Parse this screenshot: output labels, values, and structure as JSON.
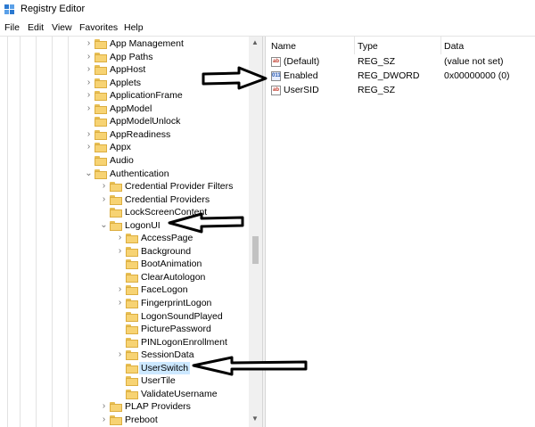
{
  "window": {
    "title": "Registry Editor",
    "icon": "regedit-icon"
  },
  "menu": [
    "File",
    "Edit",
    "View",
    "Favorites",
    "Help"
  ],
  "tree": [
    {
      "label": "App Management",
      "level": 0,
      "expander": "closed"
    },
    {
      "label": "App Paths",
      "level": 0,
      "expander": "closed"
    },
    {
      "label": "AppHost",
      "level": 0,
      "expander": "closed"
    },
    {
      "label": "Applets",
      "level": 0,
      "expander": "closed"
    },
    {
      "label": "ApplicationFrame",
      "level": 0,
      "expander": "closed"
    },
    {
      "label": "AppModel",
      "level": 0,
      "expander": "closed"
    },
    {
      "label": "AppModelUnlock",
      "level": 0,
      "expander": "none"
    },
    {
      "label": "AppReadiness",
      "level": 0,
      "expander": "closed"
    },
    {
      "label": "Appx",
      "level": 0,
      "expander": "closed"
    },
    {
      "label": "Audio",
      "level": 0,
      "expander": "none"
    },
    {
      "label": "Authentication",
      "level": 0,
      "expander": "open"
    },
    {
      "label": "Credential Provider Filters",
      "level": 1,
      "expander": "closed"
    },
    {
      "label": "Credential Providers",
      "level": 1,
      "expander": "closed"
    },
    {
      "label": "LockScreenContent",
      "level": 1,
      "expander": "none"
    },
    {
      "label": "LogonUI",
      "level": 1,
      "expander": "open"
    },
    {
      "label": "AccessPage",
      "level": 2,
      "expander": "closed"
    },
    {
      "label": "Background",
      "level": 2,
      "expander": "closed"
    },
    {
      "label": "BootAnimation",
      "level": 2,
      "expander": "none"
    },
    {
      "label": "ClearAutologon",
      "level": 2,
      "expander": "none"
    },
    {
      "label": "FaceLogon",
      "level": 2,
      "expander": "closed"
    },
    {
      "label": "FingerprintLogon",
      "level": 2,
      "expander": "closed"
    },
    {
      "label": "LogonSoundPlayed",
      "level": 2,
      "expander": "none"
    },
    {
      "label": "PicturePassword",
      "level": 2,
      "expander": "none"
    },
    {
      "label": "PINLogonEnrollment",
      "level": 2,
      "expander": "none"
    },
    {
      "label": "SessionData",
      "level": 2,
      "expander": "closed"
    },
    {
      "label": "UserSwitch",
      "level": 2,
      "expander": "none",
      "selected": true
    },
    {
      "label": "UserTile",
      "level": 2,
      "expander": "none"
    },
    {
      "label": "ValidateUsername",
      "level": 2,
      "expander": "none"
    },
    {
      "label": "PLAP Providers",
      "level": 1,
      "expander": "closed"
    },
    {
      "label": "Preboot",
      "level": 1,
      "expander": "closed"
    }
  ],
  "list": {
    "headers": {
      "name": "Name",
      "type": "Type",
      "data": "Data"
    },
    "rows": [
      {
        "name": "(Default)",
        "type": "REG_SZ",
        "data": "(value not set)",
        "icon": "ab"
      },
      {
        "name": "Enabled",
        "type": "REG_DWORD",
        "data": "0x00000000 (0)",
        "icon": "011"
      },
      {
        "name": "UserSID",
        "type": "REG_SZ",
        "data": "",
        "icon": "ab"
      }
    ]
  },
  "annotations": [
    "arrow-enabled",
    "arrow-logonui",
    "arrow-userswitch"
  ]
}
